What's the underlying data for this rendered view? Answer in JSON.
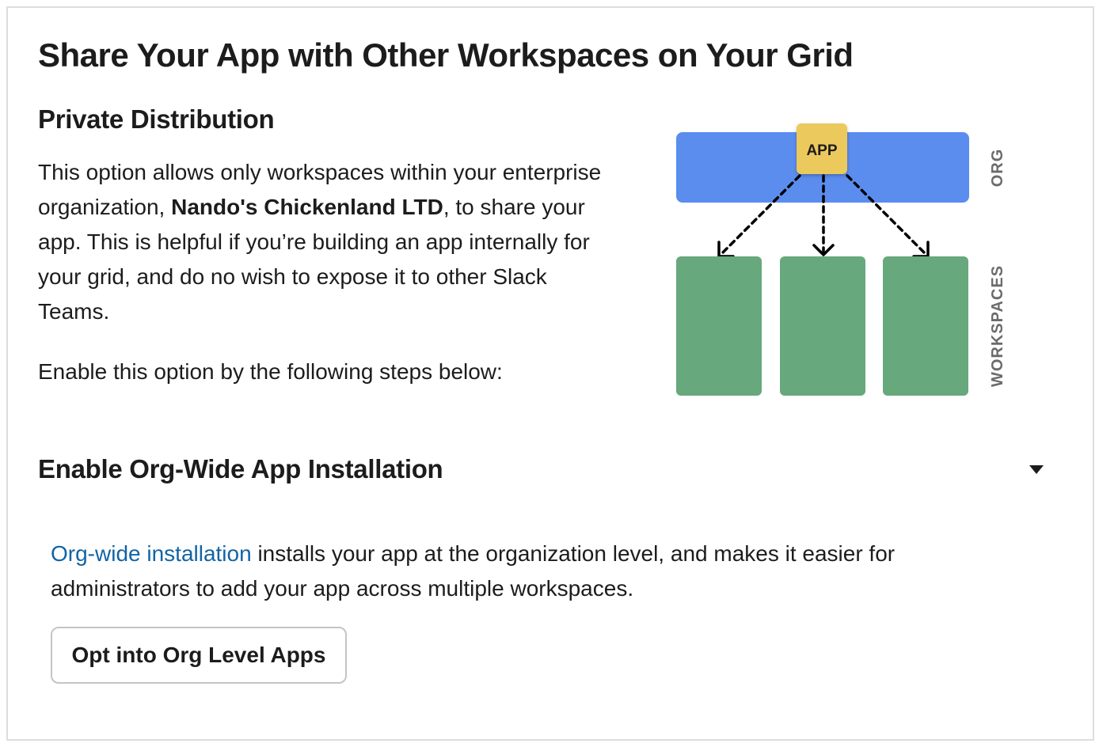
{
  "header": {
    "title": "Share Your App with Other Workspaces on Your Grid"
  },
  "private_distribution": {
    "title": "Private Distribution",
    "desc_part1": "This option allows only workspaces within your enterprise organization, ",
    "org_name": "Nando's Chickenland LTD",
    "desc_part2": ", to share your app. This is helpful if you’re building an app internally for your grid, and do no wish to expose it to other Slack Teams.",
    "steps_text": "Enable this option by the following steps below:"
  },
  "diagram": {
    "app_label": "APP",
    "org_label": "ORG",
    "workspaces_label": "WORKSPACES",
    "colors": {
      "org_bar": "#5b8def",
      "app_box": "#ecc95b",
      "workspace": "#67a87c",
      "side_label": "#6b6b6b"
    }
  },
  "org_wide": {
    "title": "Enable Org-Wide App Installation",
    "caret_icon": "caret-down-icon",
    "link_text": "Org-wide installation",
    "desc_text": " installs your app at the organization level, and makes it easier for administrators to add your app across multiple workspaces.",
    "button_label": "Opt into Org Level Apps"
  },
  "colors": {
    "link": "#1264a3",
    "text": "#1d1c1d",
    "border": "#dddddd"
  }
}
